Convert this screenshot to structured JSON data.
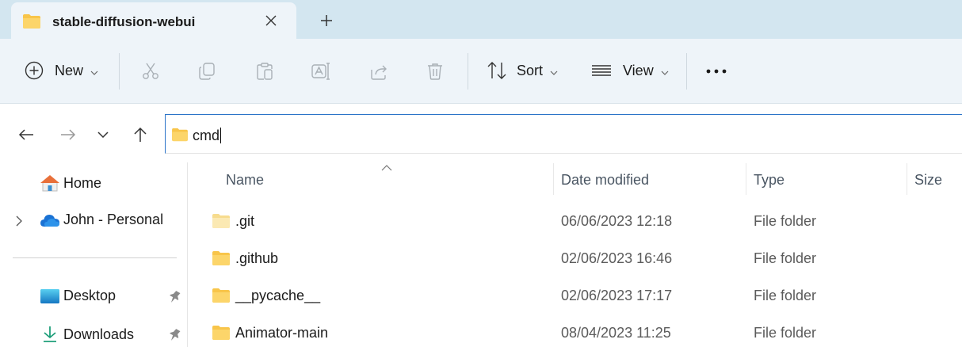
{
  "tab": {
    "title": "stable-diffusion-webui"
  },
  "toolbar": {
    "new_label": "New",
    "sort_label": "Sort",
    "view_label": "View"
  },
  "address": {
    "path": "cmd"
  },
  "sidebar": {
    "items": [
      {
        "label": "Home"
      },
      {
        "label": "John - Personal"
      },
      {
        "label": "Desktop"
      },
      {
        "label": "Downloads"
      }
    ]
  },
  "columns": {
    "name": "Name",
    "date": "Date modified",
    "type": "Type",
    "size": "Size"
  },
  "files": [
    {
      "name": ".git",
      "date": "06/06/2023 12:18",
      "type": "File folder"
    },
    {
      "name": ".github",
      "date": "02/06/2023 16:46",
      "type": "File folder"
    },
    {
      "name": "__pycache__",
      "date": "02/06/2023 17:17",
      "type": "File folder"
    },
    {
      "name": "Animator-main",
      "date": "08/04/2023 11:25",
      "type": "File folder"
    }
  ],
  "colors": {
    "tabstrip_bg": "#d3e6f0",
    "toolbar_bg": "#eef4f9",
    "accent": "#2b74c8",
    "folder_yellow": "#f8c54a"
  }
}
